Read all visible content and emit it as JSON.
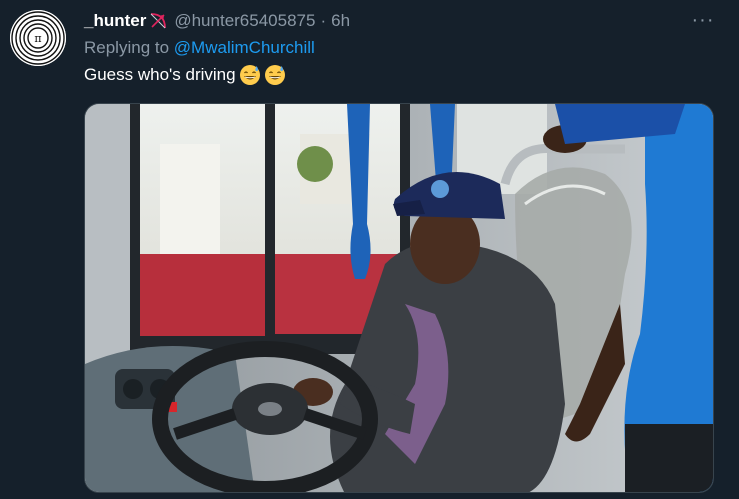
{
  "tweet": {
    "display_name": "_hunter",
    "name_emoji": "bow-and-arrow-icon",
    "handle": "@hunter65405875",
    "separator": "·",
    "time": "6h",
    "replying_prefix": "Replying to",
    "replying_to": "@MwalimChurchill",
    "text": "Guess who's driving",
    "text_emojis": [
      "grinning-sweat-emoji",
      "grinning-sweat-emoji"
    ],
    "more_label": "···"
  },
  "colors": {
    "background": "#15202b",
    "secondary_text": "#8b98a5",
    "link": "#1d9bf0",
    "name_emoji": "#e0245e"
  }
}
